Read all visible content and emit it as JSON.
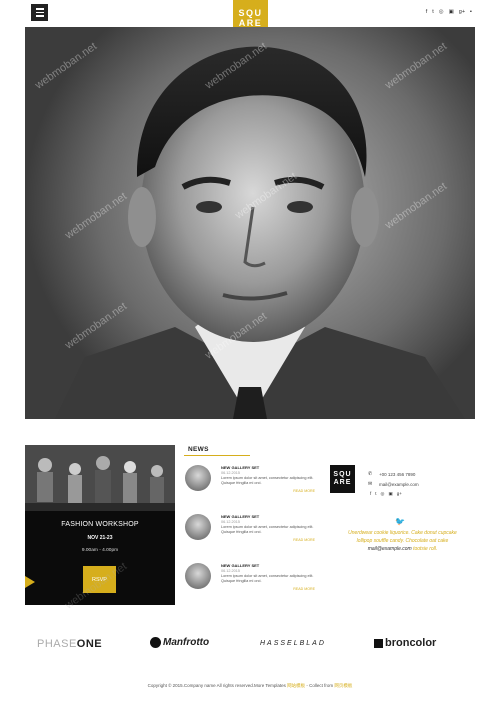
{
  "header": {
    "logo_line1": "SQU",
    "logo_line2": "ARE",
    "social": [
      "f",
      "t",
      "◎",
      "▣",
      "g+",
      "▪"
    ]
  },
  "hero": {
    "watermark": "webmoban.net"
  },
  "workshop": {
    "title": "FASHION WORKSHOP",
    "date": "NOV 21-23",
    "time": "9.00am - 4.00pm",
    "button": "RSVP"
  },
  "news": {
    "heading": "NEWS",
    "items": [
      {
        "title": "NEW GALLERY SET",
        "date": "06.12.2015",
        "text": "Lorem ipsum dolor sit amet, consectetur adipiscing elit. Quisque fringilla mi orci.",
        "more": "READ MORE"
      },
      {
        "title": "NEW GALLERY SET",
        "date": "06.12.2015",
        "text": "Lorem ipsum dolor sit amet, consectetur adipiscing elit. Quisque fringilla mi orci.",
        "more": "READ MORE"
      },
      {
        "title": "NEW GALLERY SET",
        "date": "06.12.2015",
        "text": "Lorem ipsum dolor sit amet, consectetur adipiscing elit. Quisque fringilla mi orci.",
        "more": "READ MORE"
      }
    ]
  },
  "contact": {
    "logo_line1": "SQU",
    "logo_line2": "ARE",
    "phone": "+00 123 456 7890",
    "email": "mail@example.com",
    "social": [
      "f",
      "t",
      "◎",
      "▣",
      "g+"
    ]
  },
  "twitter": {
    "tweet_part1": "Unerdwear cookie liquorice. Cake donut cupcake lollipop souffle candy. Chocolate oat cake",
    "tweet_mail": "mail@example.com",
    "tweet_part2": "tootsie roll."
  },
  "brands": {
    "phaseone_a": "PHASE",
    "phaseone_b": "ONE",
    "manfrotto": "Manfrotto",
    "hasselblad": "HASSELBLAD",
    "broncolor": "broncolor"
  },
  "footer": {
    "text": "Copyright © 2015.Company name All rights reserved.More Templates ",
    "link1": "网站模板",
    "mid": " - Collect from ",
    "link2": "网页模板"
  },
  "colors": {
    "accent": "#d6ae1c",
    "dark": "#0b0b0b"
  }
}
